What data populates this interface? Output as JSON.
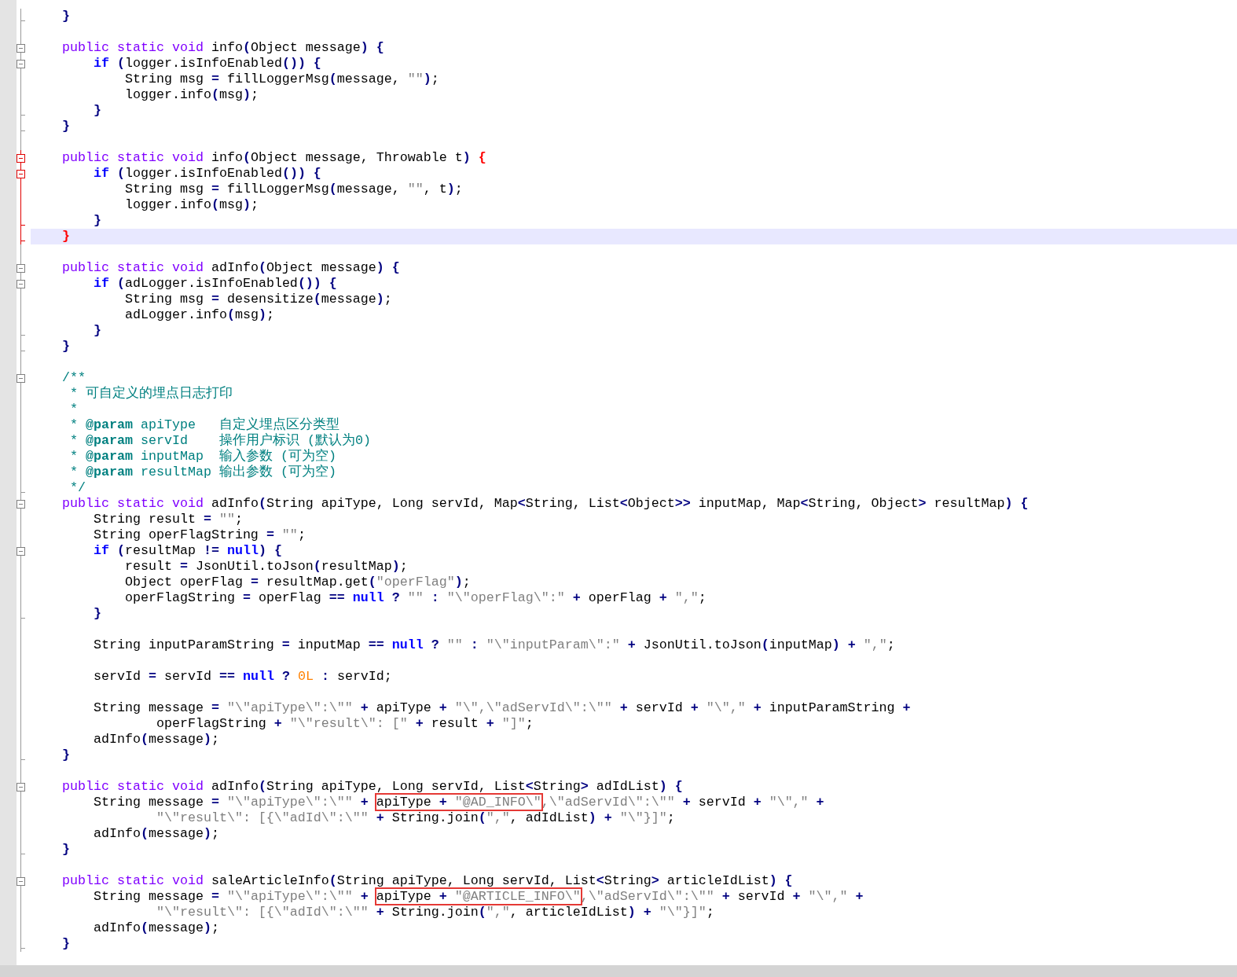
{
  "editor": {
    "lines": [
      {
        "collapsible": false,
        "block_end": true,
        "current": false,
        "highlighted": false,
        "tokens": [
          {
            "kind": "operator",
            "text": "    }"
          }
        ]
      },
      {
        "collapsible": false,
        "block_end": false,
        "current": false,
        "highlighted": false
      },
      {
        "collapsible": true,
        "block_end": false,
        "current": false,
        "highlighted": false,
        "tokens": [
          {
            "kind": "keyword",
            "text": "    public static void"
          },
          {
            "kind": "plain",
            "text": " info"
          },
          {
            "kind": "operator",
            "text": "("
          },
          {
            "kind": "plain",
            "text": "Object message"
          },
          {
            "kind": "operator",
            "text": ") {"
          }
        ]
      },
      {
        "collapsible": true,
        "block_end": false,
        "current": false,
        "highlighted": false,
        "tokens": [
          {
            "kind": "control",
            "text": "        if"
          },
          {
            "kind": "operator",
            "text": " ("
          },
          {
            "kind": "plain",
            "text": "logger.isInfoEnabled"
          },
          {
            "kind": "operator",
            "text": "()) {"
          }
        ]
      },
      {
        "collapsible": false,
        "block_end": false,
        "current": false,
        "highlighted": false,
        "tokens": [
          {
            "kind": "plain",
            "text": "            String msg "
          },
          {
            "kind": "operator",
            "text": "="
          },
          {
            "kind": "plain",
            "text": " fillLoggerMsg"
          },
          {
            "kind": "operator",
            "text": "("
          },
          {
            "kind": "plain",
            "text": "message, "
          },
          {
            "kind": "string",
            "text": "\"\""
          },
          {
            "kind": "operator",
            "text": ")"
          },
          {
            "kind": "plain",
            "text": ";"
          }
        ]
      },
      {
        "collapsible": false,
        "block_end": false,
        "current": false,
        "highlighted": false,
        "tokens": [
          {
            "kind": "plain",
            "text": "            logger.info"
          },
          {
            "kind": "operator",
            "text": "("
          },
          {
            "kind": "plain",
            "text": "msg"
          },
          {
            "kind": "operator",
            "text": ")"
          },
          {
            "kind": "plain",
            "text": ";"
          }
        ]
      },
      {
        "collapsible": false,
        "block_end": true,
        "current": false,
        "highlighted": false,
        "tokens": [
          {
            "kind": "operator",
            "text": "        }"
          }
        ]
      },
      {
        "collapsible": false,
        "block_end": true,
        "current": false,
        "highlighted": false,
        "tokens": [
          {
            "kind": "operator",
            "text": "    }"
          }
        ]
      },
      {
        "collapsible": false,
        "block_end": false,
        "current": false,
        "highlighted": false
      },
      {
        "collapsible": true,
        "block_end": false,
        "current": true,
        "highlighted": false,
        "tokens": [
          {
            "kind": "keyword",
            "text": "    public static void"
          },
          {
            "kind": "plain",
            "text": " info"
          },
          {
            "kind": "operator",
            "text": "("
          },
          {
            "kind": "plain",
            "text": "Object message, Throwable t"
          },
          {
            "kind": "operator",
            "text": ")"
          },
          {
            "kind": "brace_match",
            "text": " {"
          }
        ]
      },
      {
        "collapsible": true,
        "block_end": false,
        "current": true,
        "highlighted": false,
        "tokens": [
          {
            "kind": "control",
            "text": "        if"
          },
          {
            "kind": "operator",
            "text": " ("
          },
          {
            "kind": "plain",
            "text": "logger.isInfoEnabled"
          },
          {
            "kind": "operator",
            "text": "()) {"
          }
        ]
      },
      {
        "collapsible": false,
        "block_end": false,
        "current": true,
        "highlighted": false,
        "tokens": [
          {
            "kind": "plain",
            "text": "            String msg "
          },
          {
            "kind": "operator",
            "text": "="
          },
          {
            "kind": "plain",
            "text": " fillLoggerMsg"
          },
          {
            "kind": "operator",
            "text": "("
          },
          {
            "kind": "plain",
            "text": "message, "
          },
          {
            "kind": "string",
            "text": "\"\""
          },
          {
            "kind": "plain",
            "text": ", t"
          },
          {
            "kind": "operator",
            "text": ")"
          },
          {
            "kind": "plain",
            "text": ";"
          }
        ]
      },
      {
        "collapsible": false,
        "block_end": false,
        "current": true,
        "highlighted": false,
        "tokens": [
          {
            "kind": "plain",
            "text": "            logger.info"
          },
          {
            "kind": "operator",
            "text": "("
          },
          {
            "kind": "plain",
            "text": "msg"
          },
          {
            "kind": "operator",
            "text": ")"
          },
          {
            "kind": "plain",
            "text": ";"
          }
        ]
      },
      {
        "collapsible": false,
        "block_end": true,
        "current": true,
        "highlighted": false,
        "tokens": [
          {
            "kind": "operator",
            "text": "        }"
          }
        ]
      },
      {
        "collapsible": false,
        "block_end": true,
        "current": true,
        "highlighted": true,
        "tokens": [
          {
            "kind": "brace_match",
            "text": "    }"
          }
        ]
      },
      {
        "collapsible": false,
        "block_end": false,
        "current": false,
        "highlighted": false
      },
      {
        "collapsible": true,
        "block_end": false,
        "current": false,
        "highlighted": false,
        "tokens": [
          {
            "kind": "keyword",
            "text": "    public static void"
          },
          {
            "kind": "plain",
            "text": " adInfo"
          },
          {
            "kind": "operator",
            "text": "("
          },
          {
            "kind": "plain",
            "text": "Object message"
          },
          {
            "kind": "operator",
            "text": ") {"
          }
        ]
      },
      {
        "collapsible": true,
        "block_end": false,
        "current": false,
        "highlighted": false,
        "tokens": [
          {
            "kind": "control",
            "text": "        if"
          },
          {
            "kind": "operator",
            "text": " ("
          },
          {
            "kind": "plain",
            "text": "adLogger.isInfoEnabled"
          },
          {
            "kind": "operator",
            "text": "()) {"
          }
        ]
      },
      {
        "collapsible": false,
        "block_end": false,
        "current": false,
        "highlighted": false,
        "tokens": [
          {
            "kind": "plain",
            "text": "            String msg "
          },
          {
            "kind": "operator",
            "text": "="
          },
          {
            "kind": "plain",
            "text": " desensitize"
          },
          {
            "kind": "operator",
            "text": "("
          },
          {
            "kind": "plain",
            "text": "message"
          },
          {
            "kind": "operator",
            "text": ")"
          },
          {
            "kind": "plain",
            "text": ";"
          }
        ]
      },
      {
        "collapsible": false,
        "block_end": false,
        "current": false,
        "highlighted": false,
        "tokens": [
          {
            "kind": "plain",
            "text": "            adLogger.info"
          },
          {
            "kind": "operator",
            "text": "("
          },
          {
            "kind": "plain",
            "text": "msg"
          },
          {
            "kind": "operator",
            "text": ")"
          },
          {
            "kind": "plain",
            "text": ";"
          }
        ]
      },
      {
        "collapsible": false,
        "block_end": true,
        "current": false,
        "highlighted": false,
        "tokens": [
          {
            "kind": "operator",
            "text": "        }"
          }
        ]
      },
      {
        "collapsible": false,
        "block_end": true,
        "current": false,
        "highlighted": false,
        "tokens": [
          {
            "kind": "operator",
            "text": "    }"
          }
        ]
      },
      {
        "collapsible": false,
        "block_end": false,
        "current": false,
        "highlighted": false
      },
      {
        "collapsible": true,
        "block_end": false,
        "current": false,
        "highlighted": false,
        "tokens": [
          {
            "kind": "comment",
            "text": "    /**"
          }
        ]
      },
      {
        "collapsible": false,
        "block_end": false,
        "current": false,
        "highlighted": false,
        "tokens": [
          {
            "kind": "comment",
            "text": "     * 可自定义的埋点日志打印"
          }
        ]
      },
      {
        "collapsible": false,
        "block_end": false,
        "current": false,
        "highlighted": false,
        "tokens": [
          {
            "kind": "comment",
            "text": "     *"
          }
        ]
      },
      {
        "collapsible": false,
        "block_end": false,
        "current": false,
        "highlighted": false,
        "tokens": [
          {
            "kind": "comment",
            "text": "     * "
          },
          {
            "kind": "doc_tag",
            "text": "@param"
          },
          {
            "kind": "comment",
            "text": " apiType   自定义埋点区分类型"
          }
        ]
      },
      {
        "collapsible": false,
        "block_end": false,
        "current": false,
        "highlighted": false,
        "tokens": [
          {
            "kind": "comment",
            "text": "     * "
          },
          {
            "kind": "doc_tag",
            "text": "@param"
          },
          {
            "kind": "comment",
            "text": " servId    操作用户标识 (默认为0)"
          }
        ]
      },
      {
        "collapsible": false,
        "block_end": false,
        "current": false,
        "highlighted": false,
        "tokens": [
          {
            "kind": "comment",
            "text": "     * "
          },
          {
            "kind": "doc_tag",
            "text": "@param"
          },
          {
            "kind": "comment",
            "text": " inputMap  输入参数 (可为空)"
          }
        ]
      },
      {
        "collapsible": false,
        "block_end": false,
        "current": false,
        "highlighted": false,
        "tokens": [
          {
            "kind": "comment",
            "text": "     * "
          },
          {
            "kind": "doc_tag",
            "text": "@param"
          },
          {
            "kind": "comment",
            "text": " resultMap 输出参数 (可为空)"
          }
        ]
      },
      {
        "collapsible": false,
        "block_end": true,
        "current": false,
        "highlighted": false,
        "tokens": [
          {
            "kind": "comment",
            "text": "     */"
          }
        ]
      },
      {
        "collapsible": true,
        "block_end": false,
        "current": false,
        "highlighted": false,
        "tokens": [
          {
            "kind": "keyword",
            "text": "    public static void"
          },
          {
            "kind": "plain",
            "text": " adInfo"
          },
          {
            "kind": "operator",
            "text": "("
          },
          {
            "kind": "plain",
            "text": "String apiType, Long servId, Map"
          },
          {
            "kind": "operator",
            "text": "<"
          },
          {
            "kind": "plain",
            "text": "String, List"
          },
          {
            "kind": "operator",
            "text": "<"
          },
          {
            "kind": "plain",
            "text": "Object"
          },
          {
            "kind": "operator",
            "text": ">>"
          },
          {
            "kind": "plain",
            "text": " inputMap, Map"
          },
          {
            "kind": "operator",
            "text": "<"
          },
          {
            "kind": "plain",
            "text": "String, Object"
          },
          {
            "kind": "operator",
            "text": ">"
          },
          {
            "kind": "plain",
            "text": " resultMap"
          },
          {
            "kind": "operator",
            "text": ") {"
          }
        ]
      },
      {
        "collapsible": false,
        "block_end": false,
        "current": false,
        "highlighted": false,
        "tokens": [
          {
            "kind": "plain",
            "text": "        String result "
          },
          {
            "kind": "operator",
            "text": "="
          },
          {
            "kind": "string",
            "text": " \"\""
          },
          {
            "kind": "plain",
            "text": ";"
          }
        ]
      },
      {
        "collapsible": false,
        "block_end": false,
        "current": false,
        "highlighted": false,
        "tokens": [
          {
            "kind": "plain",
            "text": "        String operFlagString "
          },
          {
            "kind": "operator",
            "text": "="
          },
          {
            "kind": "string",
            "text": " \"\""
          },
          {
            "kind": "plain",
            "text": ";"
          }
        ]
      },
      {
        "collapsible": true,
        "block_end": false,
        "current": false,
        "highlighted": false,
        "tokens": [
          {
            "kind": "control",
            "text": "        if"
          },
          {
            "kind": "operator",
            "text": " ("
          },
          {
            "kind": "plain",
            "text": "resultMap "
          },
          {
            "kind": "operator",
            "text": "!="
          },
          {
            "kind": "control",
            "text": " null"
          },
          {
            "kind": "operator",
            "text": ") {"
          }
        ]
      },
      {
        "collapsible": false,
        "block_end": false,
        "current": false,
        "highlighted": false,
        "tokens": [
          {
            "kind": "plain",
            "text": "            result "
          },
          {
            "kind": "operator",
            "text": "="
          },
          {
            "kind": "plain",
            "text": " JsonUtil.toJson"
          },
          {
            "kind": "operator",
            "text": "("
          },
          {
            "kind": "plain",
            "text": "resultMap"
          },
          {
            "kind": "operator",
            "text": ")"
          },
          {
            "kind": "plain",
            "text": ";"
          }
        ]
      },
      {
        "collapsible": false,
        "block_end": false,
        "current": false,
        "highlighted": false,
        "tokens": [
          {
            "kind": "plain",
            "text": "            Object operFlag "
          },
          {
            "kind": "operator",
            "text": "="
          },
          {
            "kind": "plain",
            "text": " resultMap.get"
          },
          {
            "kind": "operator",
            "text": "("
          },
          {
            "kind": "string",
            "text": "\"operFlag\""
          },
          {
            "kind": "operator",
            "text": ")"
          },
          {
            "kind": "plain",
            "text": ";"
          }
        ]
      },
      {
        "collapsible": false,
        "block_end": false,
        "current": false,
        "highlighted": false,
        "tokens": [
          {
            "kind": "plain",
            "text": "            operFlagString "
          },
          {
            "kind": "operator",
            "text": "="
          },
          {
            "kind": "plain",
            "text": " operFlag "
          },
          {
            "kind": "operator",
            "text": "=="
          },
          {
            "kind": "control",
            "text": " null"
          },
          {
            "kind": "operator",
            "text": " ?"
          },
          {
            "kind": "string",
            "text": " \"\""
          },
          {
            "kind": "operator",
            "text": " :"
          },
          {
            "kind": "string",
            "text": " \"\\\"operFlag\\\":\""
          },
          {
            "kind": "operator",
            "text": " +"
          },
          {
            "kind": "plain",
            "text": " operFlag "
          },
          {
            "kind": "operator",
            "text": "+"
          },
          {
            "kind": "string",
            "text": " \",\""
          },
          {
            "kind": "plain",
            "text": ";"
          }
        ]
      },
      {
        "collapsible": false,
        "block_end": true,
        "current": false,
        "highlighted": false,
        "tokens": [
          {
            "kind": "operator",
            "text": "        }"
          }
        ]
      },
      {
        "collapsible": false,
        "block_end": false,
        "current": false,
        "highlighted": false
      },
      {
        "collapsible": false,
        "block_end": false,
        "current": false,
        "highlighted": false,
        "tokens": [
          {
            "kind": "plain",
            "text": "        String inputParamString "
          },
          {
            "kind": "operator",
            "text": "="
          },
          {
            "kind": "plain",
            "text": " inputMap "
          },
          {
            "kind": "operator",
            "text": "=="
          },
          {
            "kind": "control",
            "text": " null"
          },
          {
            "kind": "operator",
            "text": " ?"
          },
          {
            "kind": "string",
            "text": " \"\""
          },
          {
            "kind": "operator",
            "text": " :"
          },
          {
            "kind": "string",
            "text": " \"\\\"inputParam\\\":\""
          },
          {
            "kind": "operator",
            "text": " +"
          },
          {
            "kind": "plain",
            "text": " JsonUtil.toJson"
          },
          {
            "kind": "operator",
            "text": "("
          },
          {
            "kind": "plain",
            "text": "inputMap"
          },
          {
            "kind": "operator",
            "text": ") +"
          },
          {
            "kind": "string",
            "text": " \",\""
          },
          {
            "kind": "plain",
            "text": ";"
          }
        ]
      },
      {
        "collapsible": false,
        "block_end": false,
        "current": false,
        "highlighted": false
      },
      {
        "collapsible": false,
        "block_end": false,
        "current": false,
        "highlighted": false,
        "tokens": [
          {
            "kind": "plain",
            "text": "        servId "
          },
          {
            "kind": "operator",
            "text": "="
          },
          {
            "kind": "plain",
            "text": " servId "
          },
          {
            "kind": "operator",
            "text": "=="
          },
          {
            "kind": "control",
            "text": " null"
          },
          {
            "kind": "operator",
            "text": " ?"
          },
          {
            "kind": "number",
            "text": " 0L"
          },
          {
            "kind": "operator",
            "text": " :"
          },
          {
            "kind": "plain",
            "text": " servId;"
          }
        ]
      },
      {
        "collapsible": false,
        "block_end": false,
        "current": false,
        "highlighted": false
      },
      {
        "collapsible": false,
        "block_end": false,
        "current": false,
        "highlighted": false,
        "tokens": [
          {
            "kind": "plain",
            "text": "        String message "
          },
          {
            "kind": "operator",
            "text": "="
          },
          {
            "kind": "string",
            "text": " \"\\\"apiType\\\":\\\"\""
          },
          {
            "kind": "operator",
            "text": " +"
          },
          {
            "kind": "plain",
            "text": " apiType "
          },
          {
            "kind": "operator",
            "text": "+"
          },
          {
            "kind": "string",
            "text": " \"\\\",\\\"adServId\\\":\\\"\""
          },
          {
            "kind": "operator",
            "text": " +"
          },
          {
            "kind": "plain",
            "text": " servId "
          },
          {
            "kind": "operator",
            "text": "+"
          },
          {
            "kind": "string",
            "text": " \"\\\",\""
          },
          {
            "kind": "operator",
            "text": " +"
          },
          {
            "kind": "plain",
            "text": " inputParamString "
          },
          {
            "kind": "operator",
            "text": "+"
          }
        ]
      },
      {
        "collapsible": false,
        "block_end": false,
        "current": false,
        "highlighted": false,
        "tokens": [
          {
            "kind": "plain",
            "text": "                operFlagString "
          },
          {
            "kind": "operator",
            "text": "+"
          },
          {
            "kind": "string",
            "text": " \"\\\"result\\\": [\""
          },
          {
            "kind": "operator",
            "text": " +"
          },
          {
            "kind": "plain",
            "text": " result "
          },
          {
            "kind": "operator",
            "text": "+"
          },
          {
            "kind": "string",
            "text": " \"]\""
          },
          {
            "kind": "plain",
            "text": ";"
          }
        ]
      },
      {
        "collapsible": false,
        "block_end": false,
        "current": false,
        "highlighted": false,
        "tokens": [
          {
            "kind": "plain",
            "text": "        adInfo"
          },
          {
            "kind": "operator",
            "text": "("
          },
          {
            "kind": "plain",
            "text": "message"
          },
          {
            "kind": "operator",
            "text": ")"
          },
          {
            "kind": "plain",
            "text": ";"
          }
        ]
      },
      {
        "collapsible": false,
        "block_end": true,
        "current": false,
        "highlighted": false,
        "tokens": [
          {
            "kind": "operator",
            "text": "    }"
          }
        ]
      },
      {
        "collapsible": false,
        "block_end": false,
        "current": false,
        "highlighted": false
      },
      {
        "collapsible": true,
        "block_end": false,
        "current": false,
        "highlighted": false,
        "tokens": [
          {
            "kind": "keyword",
            "text": "    public static void"
          },
          {
            "kind": "plain",
            "text": " adInfo"
          },
          {
            "kind": "operator",
            "text": "("
          },
          {
            "kind": "plain",
            "text": "String apiType, Long servId, List"
          },
          {
            "kind": "operator",
            "text": "<"
          },
          {
            "kind": "plain",
            "text": "String"
          },
          {
            "kind": "operator",
            "text": ">"
          },
          {
            "kind": "plain",
            "text": " adIdList"
          },
          {
            "kind": "operator",
            "text": ") {"
          }
        ]
      },
      {
        "collapsible": false,
        "block_end": false,
        "current": false,
        "highlighted": false,
        "tokens": [
          {
            "kind": "plain",
            "text": "        String message "
          },
          {
            "kind": "operator",
            "text": "="
          },
          {
            "kind": "string",
            "text": " \"\\\"apiType\\\":\\\"\""
          },
          {
            "kind": "operator",
            "text": " + "
          },
          {
            "kind": "box",
            "tokens": [
              {
                "kind": "plain",
                "text": "apiType "
              },
              {
                "kind": "operator",
                "text": "+"
              },
              {
                "kind": "string",
                "text": " \"@AD_INFO\\\""
              }
            ]
          },
          {
            "kind": "string",
            "text": ",\\\"adServId\\\":\\\"\""
          },
          {
            "kind": "operator",
            "text": " +"
          },
          {
            "kind": "plain",
            "text": " servId "
          },
          {
            "kind": "operator",
            "text": "+"
          },
          {
            "kind": "string",
            "text": " \"\\\",\""
          },
          {
            "kind": "operator",
            "text": " +"
          }
        ]
      },
      {
        "collapsible": false,
        "block_end": false,
        "current": false,
        "highlighted": false,
        "tokens": [
          {
            "kind": "string",
            "text": "                \"\\\"result\\\": [{\\\"adId\\\":\\\"\""
          },
          {
            "kind": "operator",
            "text": " +"
          },
          {
            "kind": "plain",
            "text": " String.join"
          },
          {
            "kind": "operator",
            "text": "("
          },
          {
            "kind": "string",
            "text": "\",\""
          },
          {
            "kind": "plain",
            "text": ", adIdList"
          },
          {
            "kind": "operator",
            "text": ") +"
          },
          {
            "kind": "string",
            "text": " \"\\\"}]\""
          },
          {
            "kind": "plain",
            "text": ";"
          }
        ]
      },
      {
        "collapsible": false,
        "block_end": false,
        "current": false,
        "highlighted": false,
        "tokens": [
          {
            "kind": "plain",
            "text": "        adInfo"
          },
          {
            "kind": "operator",
            "text": "("
          },
          {
            "kind": "plain",
            "text": "message"
          },
          {
            "kind": "operator",
            "text": ")"
          },
          {
            "kind": "plain",
            "text": ";"
          }
        ]
      },
      {
        "collapsible": false,
        "block_end": true,
        "current": false,
        "highlighted": false,
        "tokens": [
          {
            "kind": "operator",
            "text": "    }"
          }
        ]
      },
      {
        "collapsible": false,
        "block_end": false,
        "current": false,
        "highlighted": false
      },
      {
        "collapsible": true,
        "block_end": false,
        "current": false,
        "highlighted": false,
        "tokens": [
          {
            "kind": "keyword",
            "text": "    public static void"
          },
          {
            "kind": "plain",
            "text": " saleArticleInfo"
          },
          {
            "kind": "operator",
            "text": "("
          },
          {
            "kind": "plain",
            "text": "String apiType, Long servId, List"
          },
          {
            "kind": "operator",
            "text": "<"
          },
          {
            "kind": "plain",
            "text": "String"
          },
          {
            "kind": "operator",
            "text": ">"
          },
          {
            "kind": "plain",
            "text": " articleIdList"
          },
          {
            "kind": "operator",
            "text": ") {"
          }
        ]
      },
      {
        "collapsible": false,
        "block_end": false,
        "current": false,
        "highlighted": false,
        "tokens": [
          {
            "kind": "plain",
            "text": "        String message "
          },
          {
            "kind": "operator",
            "text": "="
          },
          {
            "kind": "string",
            "text": " \"\\\"apiType\\\":\\\"\""
          },
          {
            "kind": "operator",
            "text": " + "
          },
          {
            "kind": "box",
            "tokens": [
              {
                "kind": "plain",
                "text": "apiType "
              },
              {
                "kind": "operator",
                "text": "+"
              },
              {
                "kind": "string",
                "text": " \"@ARTICLE_INFO\\\""
              }
            ]
          },
          {
            "kind": "string",
            "text": ",\\\"adServId\\\":\\\"\""
          },
          {
            "kind": "operator",
            "text": " +"
          },
          {
            "kind": "plain",
            "text": " servId "
          },
          {
            "kind": "operator",
            "text": "+"
          },
          {
            "kind": "string",
            "text": " \"\\\",\""
          },
          {
            "kind": "operator",
            "text": " +"
          }
        ]
      },
      {
        "collapsible": false,
        "block_end": false,
        "current": false,
        "highlighted": false,
        "tokens": [
          {
            "kind": "string",
            "text": "                \"\\\"result\\\": [{\\\"adId\\\":\\\"\""
          },
          {
            "kind": "operator",
            "text": " +"
          },
          {
            "kind": "plain",
            "text": " String.join"
          },
          {
            "kind": "operator",
            "text": "("
          },
          {
            "kind": "string",
            "text": "\",\""
          },
          {
            "kind": "plain",
            "text": ", articleIdList"
          },
          {
            "kind": "operator",
            "text": ") +"
          },
          {
            "kind": "string",
            "text": " \"\\\"}]\""
          },
          {
            "kind": "plain",
            "text": ";"
          }
        ]
      },
      {
        "collapsible": false,
        "block_end": false,
        "current": false,
        "highlighted": false,
        "tokens": [
          {
            "kind": "plain",
            "text": "        adInfo"
          },
          {
            "kind": "operator",
            "text": "("
          },
          {
            "kind": "plain",
            "text": "message"
          },
          {
            "kind": "operator",
            "text": ")"
          },
          {
            "kind": "plain",
            "text": ";"
          }
        ]
      },
      {
        "collapsible": false,
        "block_end": true,
        "current": false,
        "highlighted": false,
        "tokens": [
          {
            "kind": "operator",
            "text": "    }"
          }
        ]
      }
    ]
  }
}
